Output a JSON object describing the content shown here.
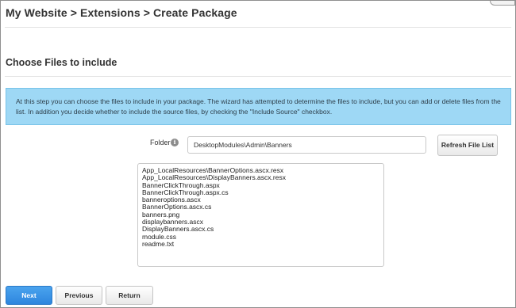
{
  "header": {
    "breadcrumb": "My Website > Extensions > Create Package"
  },
  "section": {
    "title": "Choose Files to include",
    "info_text": "At this step you can choose the files to include in your package. The wizard has attempted to determine the files to include, but you can add or delete files from the list. In addition you decide whether to include the source files, by checking the \"Include Source\" checkbox."
  },
  "folder": {
    "label": "Folder",
    "value": "DesktopModules\\Admin\\Banners",
    "info_icon": "i"
  },
  "refresh_button": "Refresh File List",
  "file_list": [
    "App_LocalResources\\BannerOptions.ascx.resx",
    "App_LocalResources\\DisplayBanners.ascx.resx",
    "BannerClickThrough.aspx",
    "BannerClickThrough.aspx.cs",
    "banneroptions.ascx",
    "BannerOptions.ascx.cs",
    "banners.png",
    "displaybanners.ascx",
    "DisplayBanners.ascx.cs",
    "module.css",
    "readme.txt"
  ],
  "buttons": {
    "next": "Next",
    "previous": "Previous",
    "return": "Return"
  },
  "colors": {
    "info_background": "#9ed8f5",
    "primary_button": "#2e86de"
  }
}
